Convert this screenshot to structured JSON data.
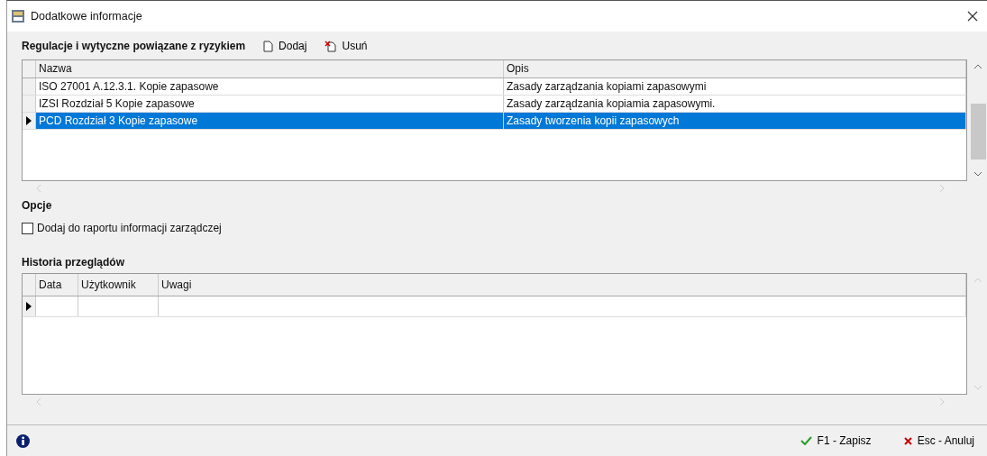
{
  "window": {
    "title": "Dodatkowe informacje"
  },
  "regulations": {
    "title": "Regulacje i wytyczne powiązane z ryzykiem",
    "actions": [
      {
        "kind": "add",
        "label": "Dodaj"
      },
      {
        "kind": "remove",
        "label": "Usuń"
      }
    ],
    "columns": [
      "Nazwa",
      "Opis"
    ],
    "rows": [
      {
        "cells": [
          "ISO 27001 A.12.3.1. Kopie zapasowe",
          "Zasady zarządzania kopiami zapasowymi"
        ],
        "selected": false
      },
      {
        "cells": [
          "IZSI Rozdział 5  Kopie zapasowe",
          "Zasady zarządzania kopiamia zapasowymi."
        ],
        "selected": false
      },
      {
        "cells": [
          "PCD Rozdział 3 Kopie zapasowe",
          "Zasady tworzenia kopii zapasowych"
        ],
        "selected": true
      }
    ]
  },
  "options": {
    "title": "Opcje",
    "items": [
      {
        "label": "Dodaj do raportu informacji zarządczej",
        "checked": false
      }
    ]
  },
  "history": {
    "title": "Historia przeglądów",
    "columns": [
      "Data",
      "Użytkownik",
      "Uwagi"
    ],
    "rows": [
      {
        "current": true
      }
    ]
  },
  "footer": {
    "buttons": [
      {
        "kind": "save",
        "label": "F1 - Zapisz"
      },
      {
        "kind": "cancel",
        "label": "Esc - Anuluj"
      }
    ]
  }
}
